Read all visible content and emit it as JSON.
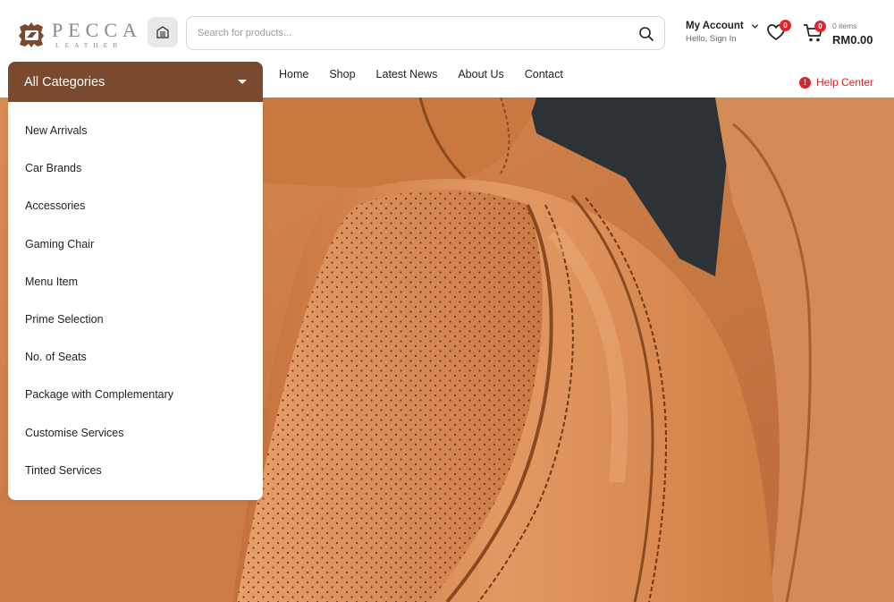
{
  "brand": {
    "name": "PECCA",
    "tagline": "LEATHER",
    "colors": {
      "primary": "#7a4a2f",
      "accent": "#e2252c"
    }
  },
  "icons": {
    "store": "store-icon",
    "search": "search-icon",
    "chevron": "chevron-down-icon",
    "wishlist": "heart-icon",
    "cart": "cart-icon",
    "help": "info-icon"
  },
  "search": {
    "placeholder": "Search for products..."
  },
  "account": {
    "title": "My Account",
    "subtitle": "Hello, Sign In"
  },
  "wishlist": {
    "count": "0"
  },
  "cart": {
    "count": "0",
    "items_label": "0 items",
    "total": "RM0.00"
  },
  "nav": {
    "items": [
      {
        "label": "Home"
      },
      {
        "label": "Shop"
      },
      {
        "label": "Latest News"
      },
      {
        "label": "About Us"
      },
      {
        "label": "Contact"
      }
    ]
  },
  "help": {
    "icon_text": "!",
    "label": "Help Center"
  },
  "categories": {
    "title": "All Categories",
    "items": [
      {
        "label": "New Arrivals"
      },
      {
        "label": "Car Brands"
      },
      {
        "label": "Accessories"
      },
      {
        "label": "Gaming Chair"
      },
      {
        "label": "Menu Item"
      },
      {
        "label": "Prime Selection"
      },
      {
        "label": "No. of Seats"
      },
      {
        "label": "Package with Complementary"
      },
      {
        "label": "Customise Services"
      },
      {
        "label": "Tinted Services"
      }
    ]
  }
}
